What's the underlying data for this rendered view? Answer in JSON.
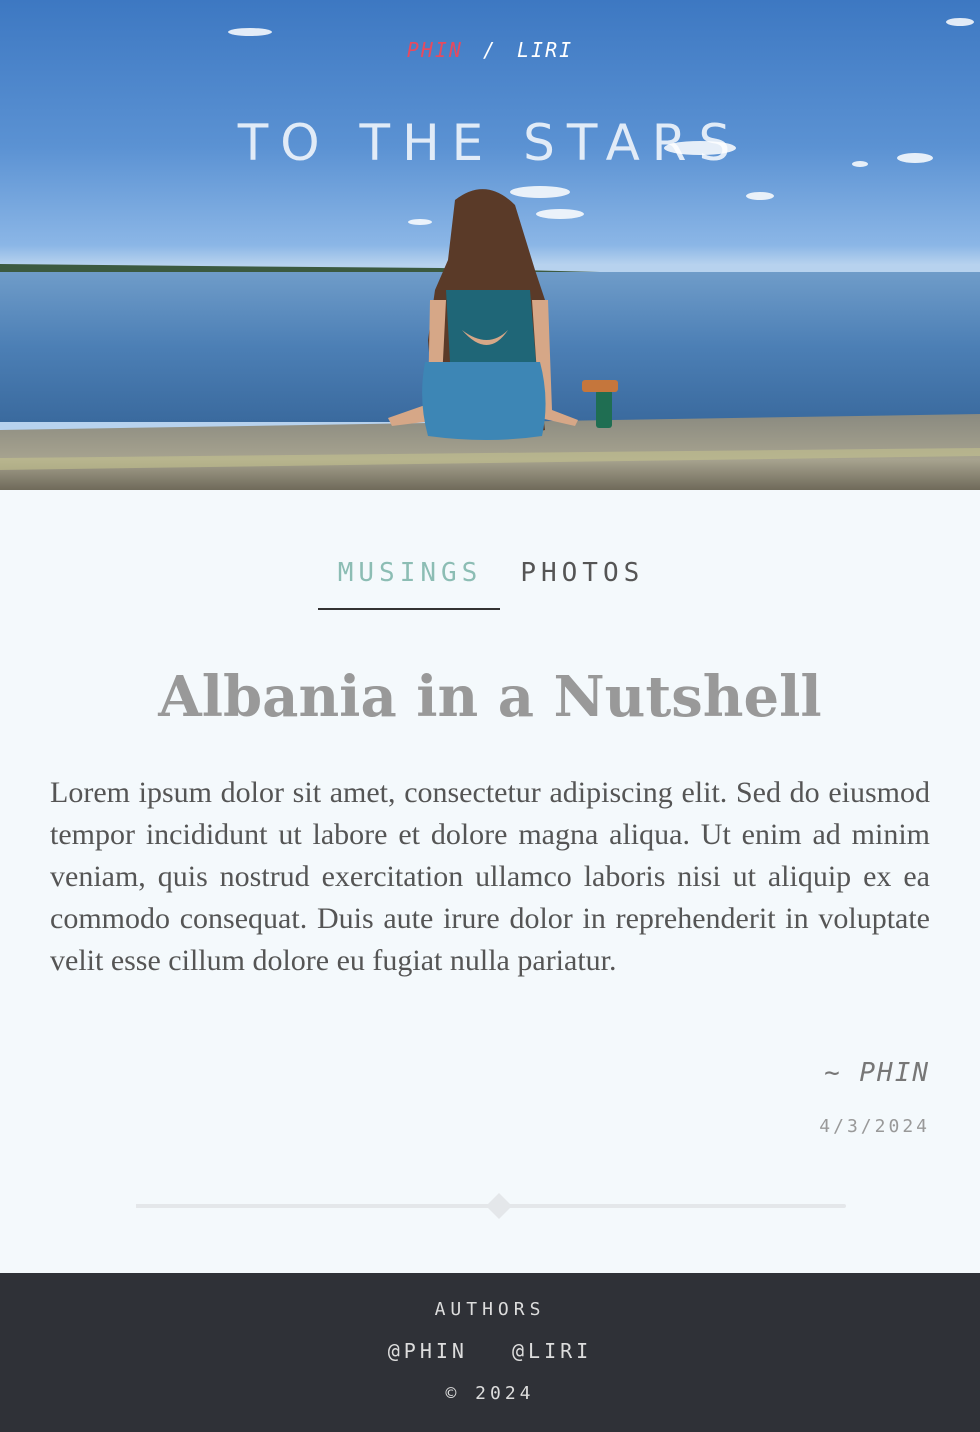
{
  "header": {
    "authors": {
      "active": "PHIN",
      "separator": "/",
      "other": "LIRI"
    },
    "site_title": "TO THE STARS"
  },
  "tabs": [
    {
      "label": "MUSINGS",
      "active": true
    },
    {
      "label": "PHOTOS",
      "active": false
    }
  ],
  "post": {
    "title": "Albania in a Nutshell",
    "body": "Lorem ipsum dolor sit amet, consectetur adipiscing elit. Sed do eiusmod tempor incididunt ut labore et dolore magna aliqua. Ut enim ad minim veniam, quis nostrud exercitation ullamco laboris nisi ut aliquip ex ea commodo consequat. Duis aute irure dolor in reprehenderit in voluptate velit esse cillum dolore eu fugiat nulla pariatur.",
    "signature": "~ PHIN",
    "date": "4/3/2024"
  },
  "footer": {
    "heading": "AUTHORS",
    "links": [
      "@PHIN",
      "@LIRI"
    ],
    "copyright": "© 2024"
  },
  "colors": {
    "accent_active_author": "#e74a5f",
    "accent_active_tab": "#8cbdb4",
    "footer_bg": "#2f3137",
    "page_bg": "#f4f9fc"
  }
}
